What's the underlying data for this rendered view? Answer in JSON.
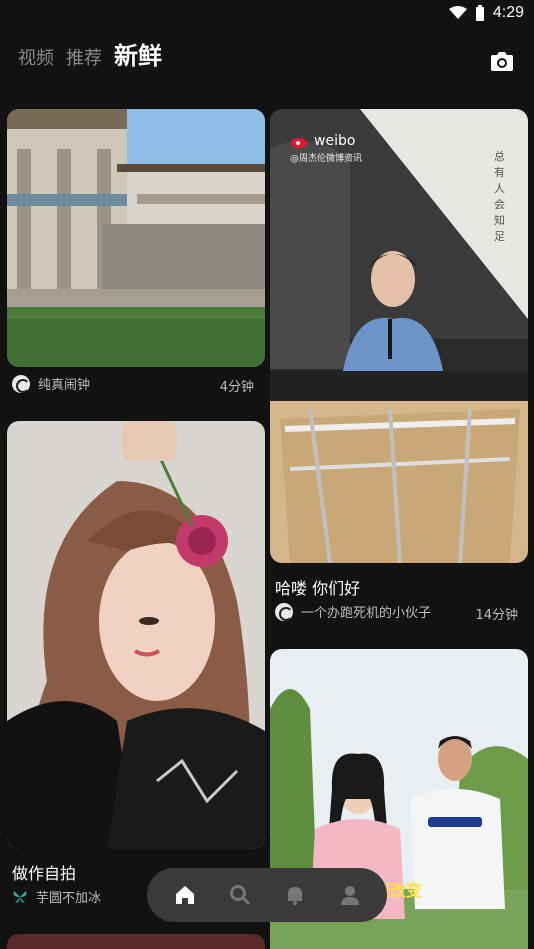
{
  "status": {
    "time": "4:29"
  },
  "tabs": [
    {
      "label": "视频"
    },
    {
      "label": "推荐"
    },
    {
      "label": "新鲜"
    }
  ],
  "feed": {
    "left": [
      {
        "title": "",
        "author": "纯真闹钟",
        "duration": "4分钟",
        "image": "house-by-lake"
      },
      {
        "title": "做作自拍",
        "author": "芋圆不加冰",
        "duration": "",
        "image": "girl-with-rose"
      }
    ],
    "right": [
      {
        "title": "哈喽 你们好",
        "author": "一个办跑死机的小伙子",
        "duration": "14分钟",
        "image": "man-playing-piano",
        "overlay": {
          "watermark": "weibo",
          "caption": "@周杰伦微博资讯",
          "vertical_text": "总有人会知足"
        }
      },
      {
        "title": "",
        "author": "",
        "duration": "",
        "image": "couple-outdoors",
        "overlay": {
          "caption": "体型改变"
        }
      }
    ]
  },
  "nav": [
    "home-icon",
    "search-icon",
    "bell-icon",
    "profile-icon"
  ],
  "colors": {
    "background": "#121212",
    "nav_bg": "#3a3a3a",
    "muted_text": "#bdbdbd"
  }
}
